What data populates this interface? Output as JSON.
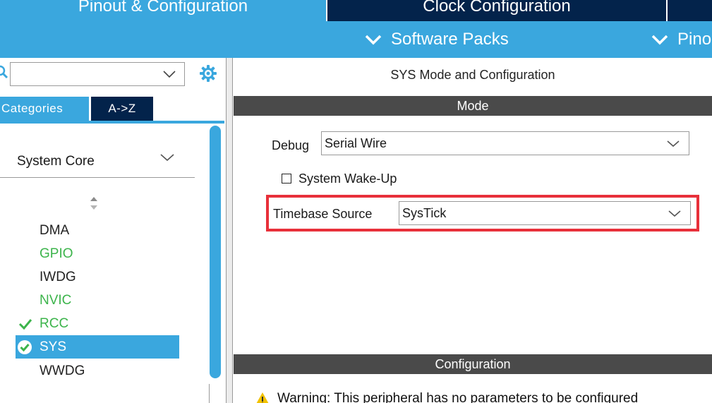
{
  "top_tabs": {
    "pinout": "Pinout & Configuration",
    "clock": "Clock Configuration"
  },
  "sub_bar": {
    "software_packs": "Software Packs",
    "pinout": "Pinout"
  },
  "left_panel": {
    "search": {
      "value": "",
      "placeholder": ""
    },
    "tabs": {
      "categories": "Categories",
      "az": "A->Z"
    },
    "group": "System Core",
    "items": [
      {
        "label": "DMA",
        "state": "normal"
      },
      {
        "label": "GPIO",
        "state": "green"
      },
      {
        "label": "IWDG",
        "state": "normal"
      },
      {
        "label": "NVIC",
        "state": "green"
      },
      {
        "label": "RCC",
        "state": "checked"
      },
      {
        "label": "SYS",
        "state": "selected"
      },
      {
        "label": "WWDG",
        "state": "normal"
      }
    ]
  },
  "right_panel": {
    "title": "SYS Mode and Configuration",
    "mode_header": "Mode",
    "debug": {
      "label": "Debug",
      "value": "Serial Wire"
    },
    "wakeup": {
      "label": "System Wake-Up",
      "checked": false
    },
    "timebase": {
      "label": "Timebase Source",
      "value": "SysTick"
    },
    "config_header": "Configuration",
    "warning": "Warning: This peripheral has no parameters to be configured"
  },
  "colors": {
    "accent_blue": "#3aa7de",
    "dark_navy": "#03234b",
    "green": "#3cb44b",
    "section_gray": "#4a4a4a",
    "highlight_red": "#e8303a",
    "warning_yellow": "#f2c200"
  }
}
